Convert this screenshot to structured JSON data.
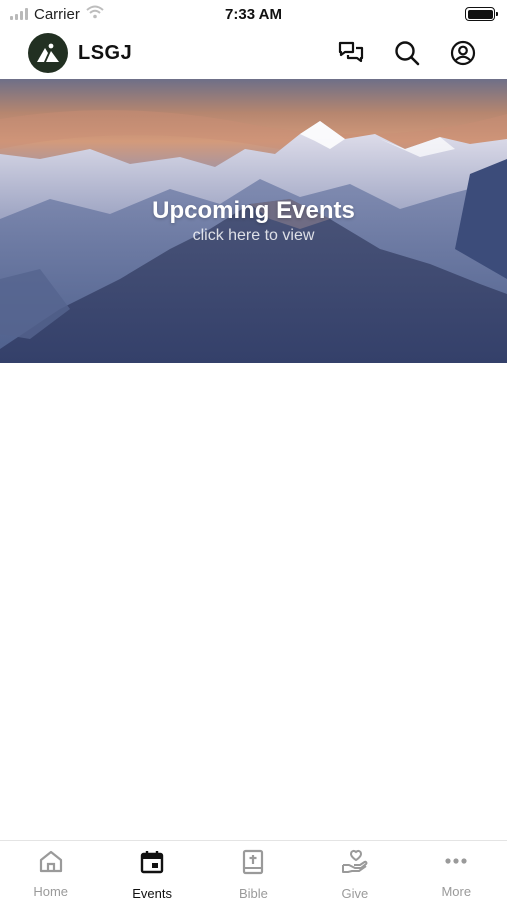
{
  "status_bar": {
    "carrier": "Carrier",
    "time": "7:33 AM"
  },
  "header": {
    "brand_name": "LSGJ",
    "icons": [
      "chat-icon",
      "search-icon",
      "account-icon"
    ]
  },
  "hero": {
    "title": "Upcoming Events",
    "subtitle": "click here to view"
  },
  "tabs": [
    {
      "label": "Home",
      "icon": "home-icon",
      "active": false
    },
    {
      "label": "Events",
      "icon": "calendar-icon",
      "active": true
    },
    {
      "label": "Bible",
      "icon": "bible-icon",
      "active": false
    },
    {
      "label": "Give",
      "icon": "give-icon",
      "active": false
    },
    {
      "label": "More",
      "icon": "more-icon",
      "active": false
    }
  ],
  "colors": {
    "logo_background": "#223022",
    "tab_active": "#111111",
    "tab_inactive": "#9a9a9a"
  }
}
